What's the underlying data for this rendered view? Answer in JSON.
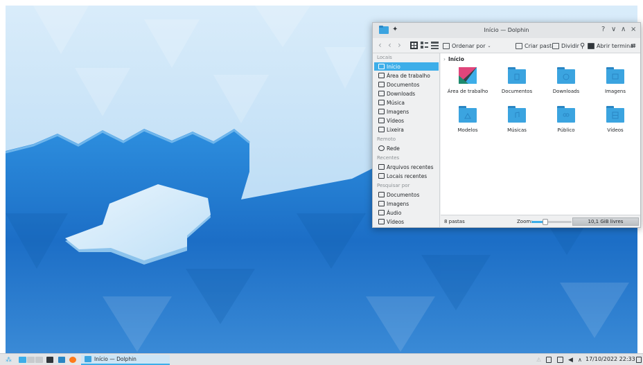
{
  "window": {
    "title": "Início — Dolphin",
    "controls": {
      "help": "?",
      "minimize": "∨",
      "maximize": "∧",
      "close": "×"
    }
  },
  "toolbar": {
    "sort_label": "Ordenar por",
    "new_folder_label": "Criar pasta",
    "split_label": "Dividir",
    "terminal_label": "Abrir terminal"
  },
  "sidebar": {
    "sections": [
      {
        "title": "Locais"
      },
      {
        "title": "Remoto"
      },
      {
        "title": "Recentes"
      },
      {
        "title": "Pesquisar por"
      }
    ],
    "places": [
      {
        "label": "Início",
        "icon": "home-icon"
      },
      {
        "label": "Área de trabalho",
        "icon": "desktop-icon"
      },
      {
        "label": "Documentos",
        "icon": "documents-icon"
      },
      {
        "label": "Downloads",
        "icon": "downloads-icon"
      },
      {
        "label": "Música",
        "icon": "music-icon"
      },
      {
        "label": "Imagens",
        "icon": "images-icon"
      },
      {
        "label": "Vídeos",
        "icon": "videos-icon"
      },
      {
        "label": "Lixeira",
        "icon": "trash-icon"
      }
    ],
    "remote": [
      {
        "label": "Rede",
        "icon": "network-icon"
      }
    ],
    "recent": [
      {
        "label": "Arquivos recentes",
        "icon": "recent-files-icon"
      },
      {
        "label": "Locais recentes",
        "icon": "recent-locations-icon"
      }
    ],
    "search": [
      {
        "label": "Documentos",
        "icon": "documents-icon"
      },
      {
        "label": "Imagens",
        "icon": "images-icon"
      },
      {
        "label": "Áudio",
        "icon": "audio-icon"
      },
      {
        "label": "Vídeos",
        "icon": "videos-icon"
      }
    ]
  },
  "breadcrumb": {
    "current": "Início"
  },
  "folders": [
    {
      "name": "Área de trabalho",
      "icon": "desktop-folder-icon"
    },
    {
      "name": "Documentos",
      "icon": "documents-folder-icon"
    },
    {
      "name": "Downloads",
      "icon": "downloads-folder-icon"
    },
    {
      "name": "Imagens",
      "icon": "images-folder-icon"
    },
    {
      "name": "Modelos",
      "icon": "templates-folder-icon"
    },
    {
      "name": "Músicas",
      "icon": "music-folder-icon"
    },
    {
      "name": "Público",
      "icon": "public-folder-icon"
    },
    {
      "name": "Vídeos",
      "icon": "videos-folder-icon"
    }
  ],
  "status": {
    "count": "8 pastas",
    "zoom_label": "Zoom:",
    "zoom_level": 0.35,
    "free_space": "10,1 GiB livres"
  },
  "taskbar": {
    "task_label": "Início — Dolphin",
    "clock": "17/10/2022 22:33"
  },
  "colors": {
    "accent": "#3daee9",
    "folder": "#3ba4e0",
    "folder_dark": "#2a86c4"
  }
}
